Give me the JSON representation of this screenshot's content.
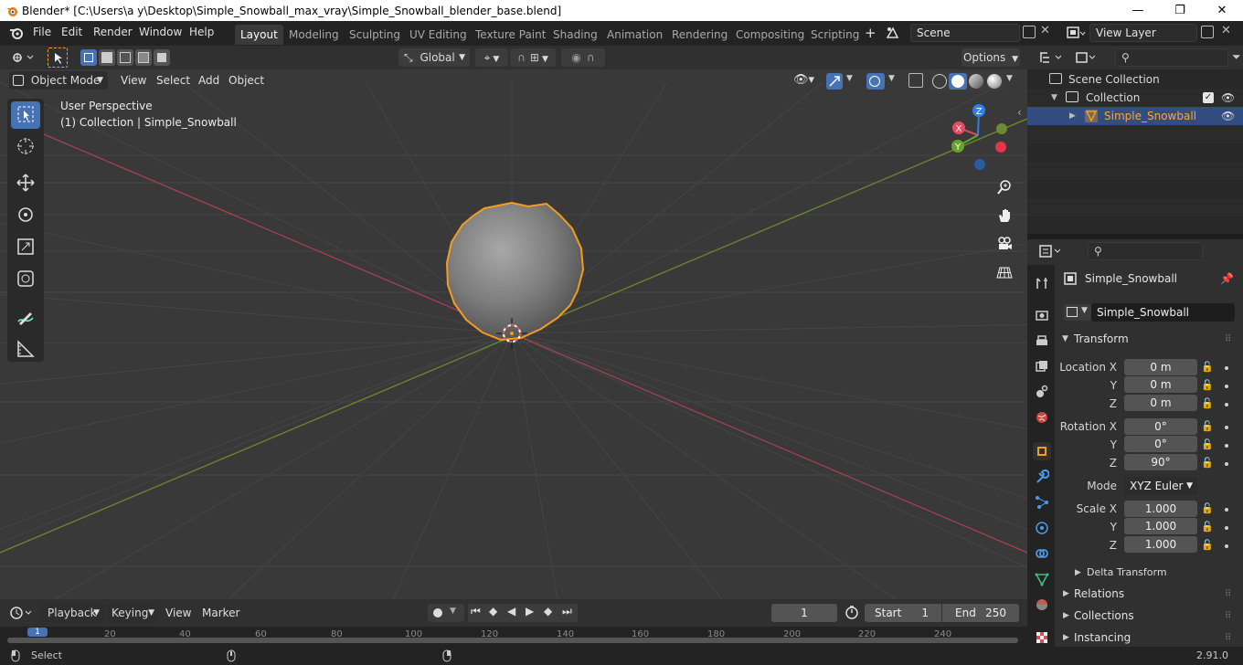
{
  "window": {
    "title": "Blender* [C:\\Users\\a y\\Desktop\\Simple_Snowball_max_vray\\Simple_Snowball_blender_base.blend]",
    "minimize": "—",
    "maximize": "❐",
    "close": "✕"
  },
  "topbar": {
    "menus": [
      "File",
      "Edit",
      "Render",
      "Window",
      "Help"
    ],
    "workspaces": [
      "Layout",
      "Modeling",
      "Sculpting",
      "UV Editing",
      "Texture Paint",
      "Shading",
      "Animation",
      "Rendering",
      "Compositing",
      "Scripting"
    ],
    "active_workspace": "Layout",
    "add_tab": "+",
    "scene": "Scene",
    "view_layer": "View Layer"
  },
  "viewport_header": {
    "orientation": "Global",
    "options": "Options",
    "mode": "Object Mode",
    "menus": [
      "View",
      "Select",
      "Add",
      "Object"
    ]
  },
  "viewport": {
    "perspective": "User Perspective",
    "collection_info": "(1) Collection | Simple_Snowball",
    "gizmo": {
      "x": "X",
      "y": "Y",
      "z": "Z"
    }
  },
  "outliner": {
    "scene_collection": "Scene Collection",
    "collection": "Collection",
    "object": "Simple_Snowball"
  },
  "properties": {
    "object_name": "Simple_Snowball",
    "object_field": "Simple_Snowball",
    "transform_label": "Transform",
    "location": {
      "label": "Location X",
      "x": "0 m",
      "y": "0 m",
      "z": "0 m"
    },
    "rotation": {
      "label": "Rotation X",
      "x": "0°",
      "y": "0°",
      "z": "90°"
    },
    "axis_y": "Y",
    "axis_z": "Z",
    "mode_label": "Mode",
    "mode_value": "XYZ Euler",
    "scale": {
      "label": "Scale X",
      "x": "1.000",
      "y": "1.000",
      "z": "1.000"
    },
    "delta_transform": "Delta Transform",
    "relations": "Relations",
    "collections": "Collections",
    "instancing": "Instancing"
  },
  "timeline": {
    "menus": [
      "Playback",
      "Keying",
      "View",
      "Marker"
    ],
    "current_frame": "1",
    "start_label": "Start",
    "start": "1",
    "end_label": "End",
    "end": "250",
    "ticks": [
      "20",
      "40",
      "60",
      "80",
      "100",
      "120",
      "140",
      "160",
      "180",
      "200",
      "220",
      "240"
    ],
    "current_tick": "1"
  },
  "statusbar": {
    "select": "Select",
    "version": "2.91.0"
  },
  "colors": {
    "accent": "#4772b3",
    "selection_outline": "#f59b1f",
    "x_axis": "#e84a5f",
    "y_axis": "#6aa32c",
    "z_axis": "#2e7fe8"
  }
}
